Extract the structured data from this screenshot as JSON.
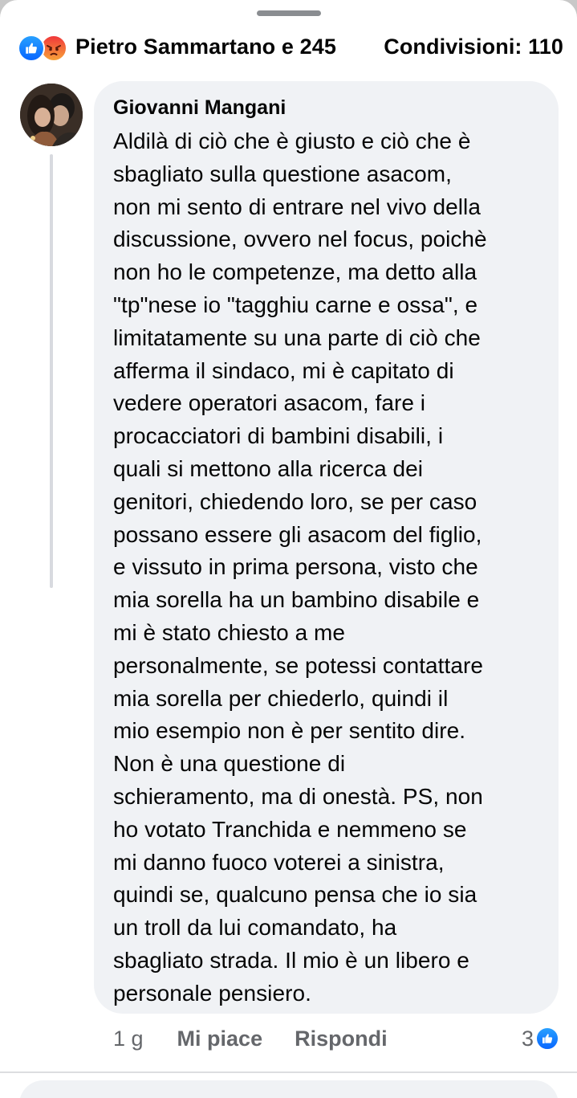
{
  "reactions": {
    "icons": [
      "like-icon",
      "angry-icon"
    ],
    "names": "Pietro Sammartano e 245",
    "shares": "Condivisioni: 110"
  },
  "comment": {
    "author": "Giovanni Mangani",
    "lines": [
      "Aldilà di ciò che è giusto e ciò che è",
      "sbagliato sulla questione asacom,",
      "non mi sento di entrare nel vivo della",
      "discussione, ovvero nel focus, poichè",
      "non ho le competenze, ma detto alla",
      "\"tp\"nese io \"tagghiu carne e ossa\", e",
      "limitatamente su una parte di ciò che",
      "afferma il sindaco, mi è capitato di",
      "vedere operatori asacom, fare i",
      "procacciatori di bambini disabili, i",
      "quali si mettono alla ricerca dei",
      "genitori, chiedendo loro, se per caso",
      "possano essere gli asacom del figlio,",
      "e vissuto in prima persona, visto che",
      "mia sorella ha un bambino disabile e",
      "mi è stato chiesto a me",
      "personalmente, se potessi contattare",
      "mia sorella per chiederlo, quindi il",
      "mio esempio non è per sentito dire.",
      "Non è una questione di",
      "schieramento, ma di onestà. PS, non",
      "ho votato Tranchida e nemmeno se",
      "mi danno fuoco voterei a sinistra,",
      "quindi se, qualcuno pensa che io sia",
      "un troll da lui comandato, ha",
      "sbagliato strada. Il mio è un libero e",
      "personale pensiero."
    ],
    "time": "1 g",
    "like_label": "Mi piace",
    "reply_label": "Rispondi",
    "reaction_count": "3",
    "reaction_icon": "like-icon"
  },
  "colors": {
    "like_blue": "#0866ff",
    "bubble_bg": "#f0f2f5",
    "secondary_text": "#65676b"
  }
}
